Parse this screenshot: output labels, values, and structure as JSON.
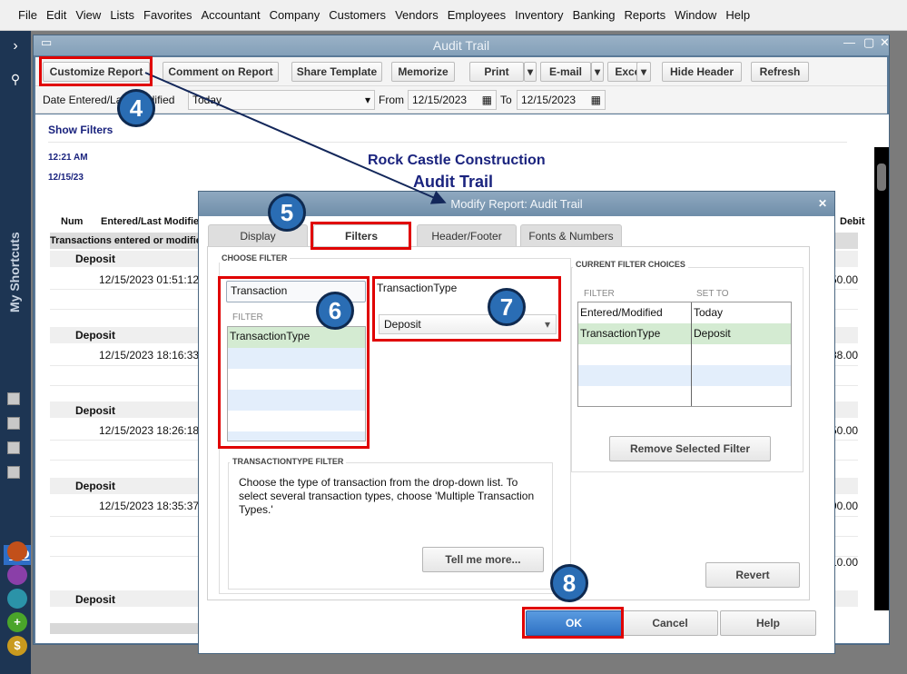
{
  "menu": [
    "File",
    "Edit",
    "View",
    "Lists",
    "Favorites",
    "Accountant",
    "Company",
    "Customers",
    "Vendors",
    "Employees",
    "Inventory",
    "Banking",
    "Reports",
    "Window",
    "Help"
  ],
  "sidebar": {
    "label": "My Shortcuts",
    "company": "CO"
  },
  "window": {
    "title": "Audit Trail"
  },
  "toolbar": {
    "customize": "Customize Report",
    "comment": "Comment on Report",
    "share": "Share Template",
    "memorize": "Memorize",
    "print": "Print",
    "email": "E-mail",
    "excel": "Excel",
    "hide_header": "Hide Header",
    "refresh": "Refresh"
  },
  "filter_row": {
    "label": "Date Entered/Last Modified",
    "period": "Today",
    "from_label": "From",
    "from": "12/15/2023",
    "to_label": "To",
    "to": "12/15/2023"
  },
  "report": {
    "show_filters": "Show Filters",
    "time": "12:21 AM",
    "date": "12/15/23",
    "company": "Rock Castle Construction",
    "title": "Audit Trail",
    "col_num": "Num",
    "col_entered": "Entered/Last Modified",
    "col_debit": "Debit",
    "group": "Transactions entered or modified",
    "rows": [
      {
        "type": "Deposit",
        "ts": "12/15/2023 01:51:12",
        "amount": "150.00"
      },
      {
        "type": "Deposit",
        "ts": "12/15/2023 18:16:33",
        "amount": "188.00"
      },
      {
        "type": "Deposit",
        "ts": "12/15/2023 18:26:18",
        "amount": "150.00"
      },
      {
        "type": "Deposit",
        "ts": "12/15/2023 18:35:37",
        "amount": "90.00"
      },
      {
        "type": "",
        "ts": "",
        "amount": "10.00"
      },
      {
        "type": "Deposit",
        "ts": "",
        "amount": ""
      }
    ]
  },
  "dialog": {
    "title": "Modify Report: Audit Trail",
    "tabs": [
      "Display",
      "Filters",
      "Header/Footer",
      "Fonts & Numbers"
    ],
    "choose_filter": "CHOOSE FILTER",
    "search_value": "Transaction",
    "filter_col": "FILTER",
    "filter_items": [
      "TransactionType"
    ],
    "selected_filter": "TransactionType",
    "selected_value": "Deposit",
    "help_heading": "TRANSACTIONTYPE FILTER",
    "help_text": "Choose the type of transaction from the drop-down list. To select several transaction types, choose 'Multiple Transaction Types.'",
    "tell_more": "Tell me more...",
    "current_heading": "CURRENT FILTER CHOICES",
    "cur_col_filter": "FILTER",
    "cur_col_set": "SET TO",
    "current": [
      {
        "filter": "Entered/Modified",
        "set": "Today"
      },
      {
        "filter": "TransactionType",
        "set": "Deposit"
      }
    ],
    "remove": "Remove Selected Filter",
    "revert": "Revert",
    "ok": "OK",
    "cancel": "Cancel",
    "help": "Help"
  },
  "annotations": [
    "4",
    "5",
    "6",
    "7",
    "8"
  ],
  "colors": {
    "highlight": "#e00000",
    "badge": "#2a6db4",
    "selected_row": "#d4ebd2"
  }
}
